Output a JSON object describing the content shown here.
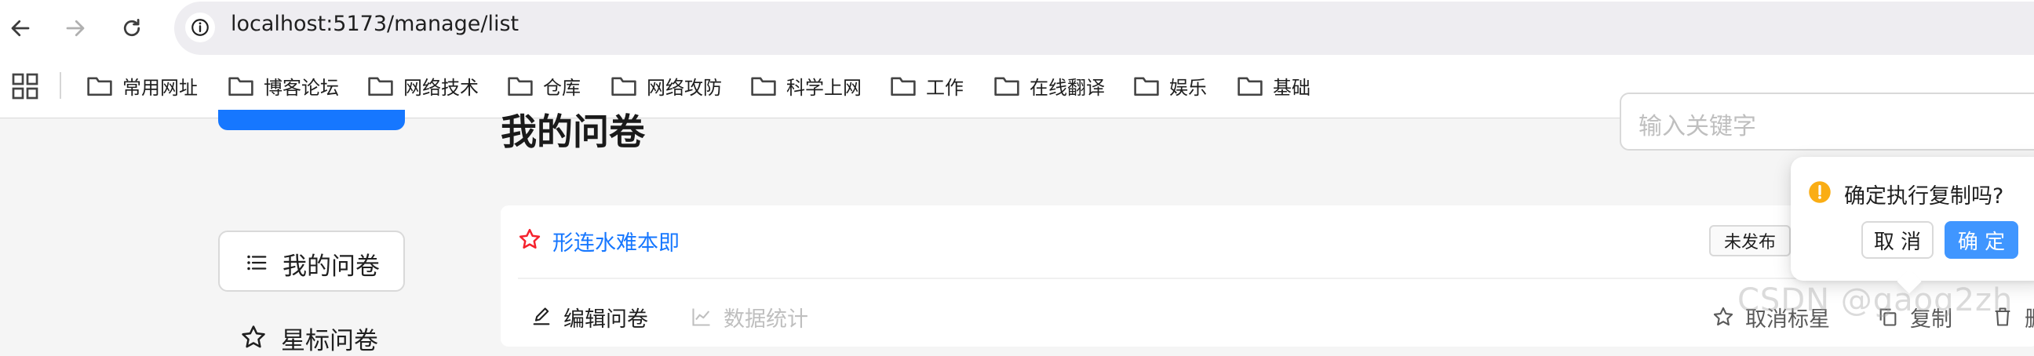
{
  "browser": {
    "url": "localhost:5173/manage/list",
    "bookmarks": [
      {
        "label": "常用网址"
      },
      {
        "label": "博客论坛"
      },
      {
        "label": "网络技术"
      },
      {
        "label": "仓库"
      },
      {
        "label": "网络攻防"
      },
      {
        "label": "科学上网"
      },
      {
        "label": "工作"
      },
      {
        "label": "在线翻译"
      },
      {
        "label": "娱乐"
      },
      {
        "label": "基础"
      }
    ]
  },
  "page": {
    "title": "我的问卷",
    "search_placeholder": "输入关键字"
  },
  "sidebar": {
    "items": [
      {
        "label": "我的问卷",
        "icon": "list-icon"
      },
      {
        "label": "星标问卷",
        "icon": "star-icon"
      }
    ]
  },
  "card": {
    "title": "形连水难本即",
    "starred": true,
    "status": "未发布",
    "actions": [
      {
        "label": "编辑问卷",
        "icon": "edit-icon"
      },
      {
        "label": "数据统计",
        "icon": "line-chart-icon"
      },
      {
        "label": "取消标星",
        "icon": "star-icon"
      },
      {
        "label": "复制",
        "icon": "copy-icon"
      },
      {
        "label": "删",
        "icon": "delete-icon"
      }
    ]
  },
  "popconfirm": {
    "message": "确定执行复制吗?",
    "cancel_label": "取 消",
    "ok_label": "确 定"
  },
  "watermark": "CSDN @gaog2zh",
  "colors": {
    "primary": "#1677ff",
    "star": "#f5222d",
    "warning": "#faad14"
  }
}
